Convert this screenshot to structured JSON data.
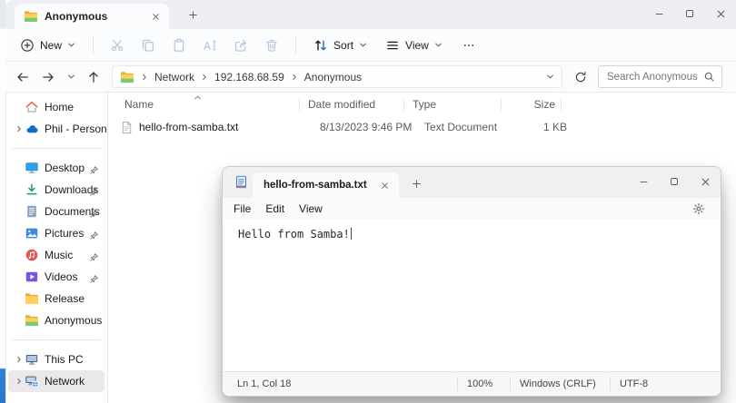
{
  "colors": {
    "desktop_accent": "#2b7cd3",
    "sidebar_selection": "#e9e9e9"
  },
  "explorer": {
    "tab_title": "Anonymous",
    "toolbar": {
      "new_label": "New",
      "sort_label": "Sort",
      "view_label": "View",
      "more_label": "…",
      "edit_icons": [
        "cut-icon",
        "copy-icon",
        "paste-icon",
        "rename-icon",
        "share-icon",
        "delete-icon"
      ]
    },
    "address": {
      "breadcrumbs": [
        "Network",
        "192.168.68.59",
        "Anonymous"
      ],
      "search_placeholder": "Search Anonymous"
    },
    "sidebar": {
      "groups": [
        {
          "items": [
            {
              "label": "Home",
              "icon": "home-icon"
            },
            {
              "label": "Phil - Personal",
              "icon": "onedrive-icon",
              "expandable": true
            }
          ]
        },
        {
          "items": [
            {
              "label": "Desktop",
              "icon": "desktop-icon",
              "pinned": true
            },
            {
              "label": "Downloads",
              "icon": "downloads-icon",
              "pinned": true
            },
            {
              "label": "Documents",
              "icon": "documents-icon",
              "pinned": true
            },
            {
              "label": "Pictures",
              "icon": "pictures-icon",
              "pinned": true
            },
            {
              "label": "Music",
              "icon": "music-icon",
              "pinned": true
            },
            {
              "label": "Videos",
              "icon": "videos-icon",
              "pinned": true
            },
            {
              "label": "Release",
              "icon": "folder-icon"
            },
            {
              "label": "Anonymous",
              "icon": "shared-folder-icon"
            }
          ]
        },
        {
          "items": [
            {
              "label": "This PC",
              "icon": "this-pc-icon",
              "expandable": true
            },
            {
              "label": "Network",
              "icon": "network-icon",
              "expandable": true,
              "selected": true
            }
          ]
        }
      ]
    },
    "files": {
      "columns": [
        "Name",
        "Date modified",
        "Type",
        "Size"
      ],
      "sort": {
        "column": "Name",
        "direction": "ascending"
      },
      "rows": [
        {
          "icon": "text-file-icon",
          "name": "hello-from-samba.txt",
          "date_modified": "8/13/2023 9:46 PM",
          "type": "Text Document",
          "size": "1 KB"
        }
      ]
    }
  },
  "notepad": {
    "tab_title": "hello-from-samba.txt",
    "menus": [
      "File",
      "Edit",
      "View"
    ],
    "content": "Hello from Samba!",
    "status": {
      "position": "Ln 1, Col 18",
      "zoom": "100%",
      "line_ending": "Windows (CRLF)",
      "encoding": "UTF-8"
    }
  }
}
